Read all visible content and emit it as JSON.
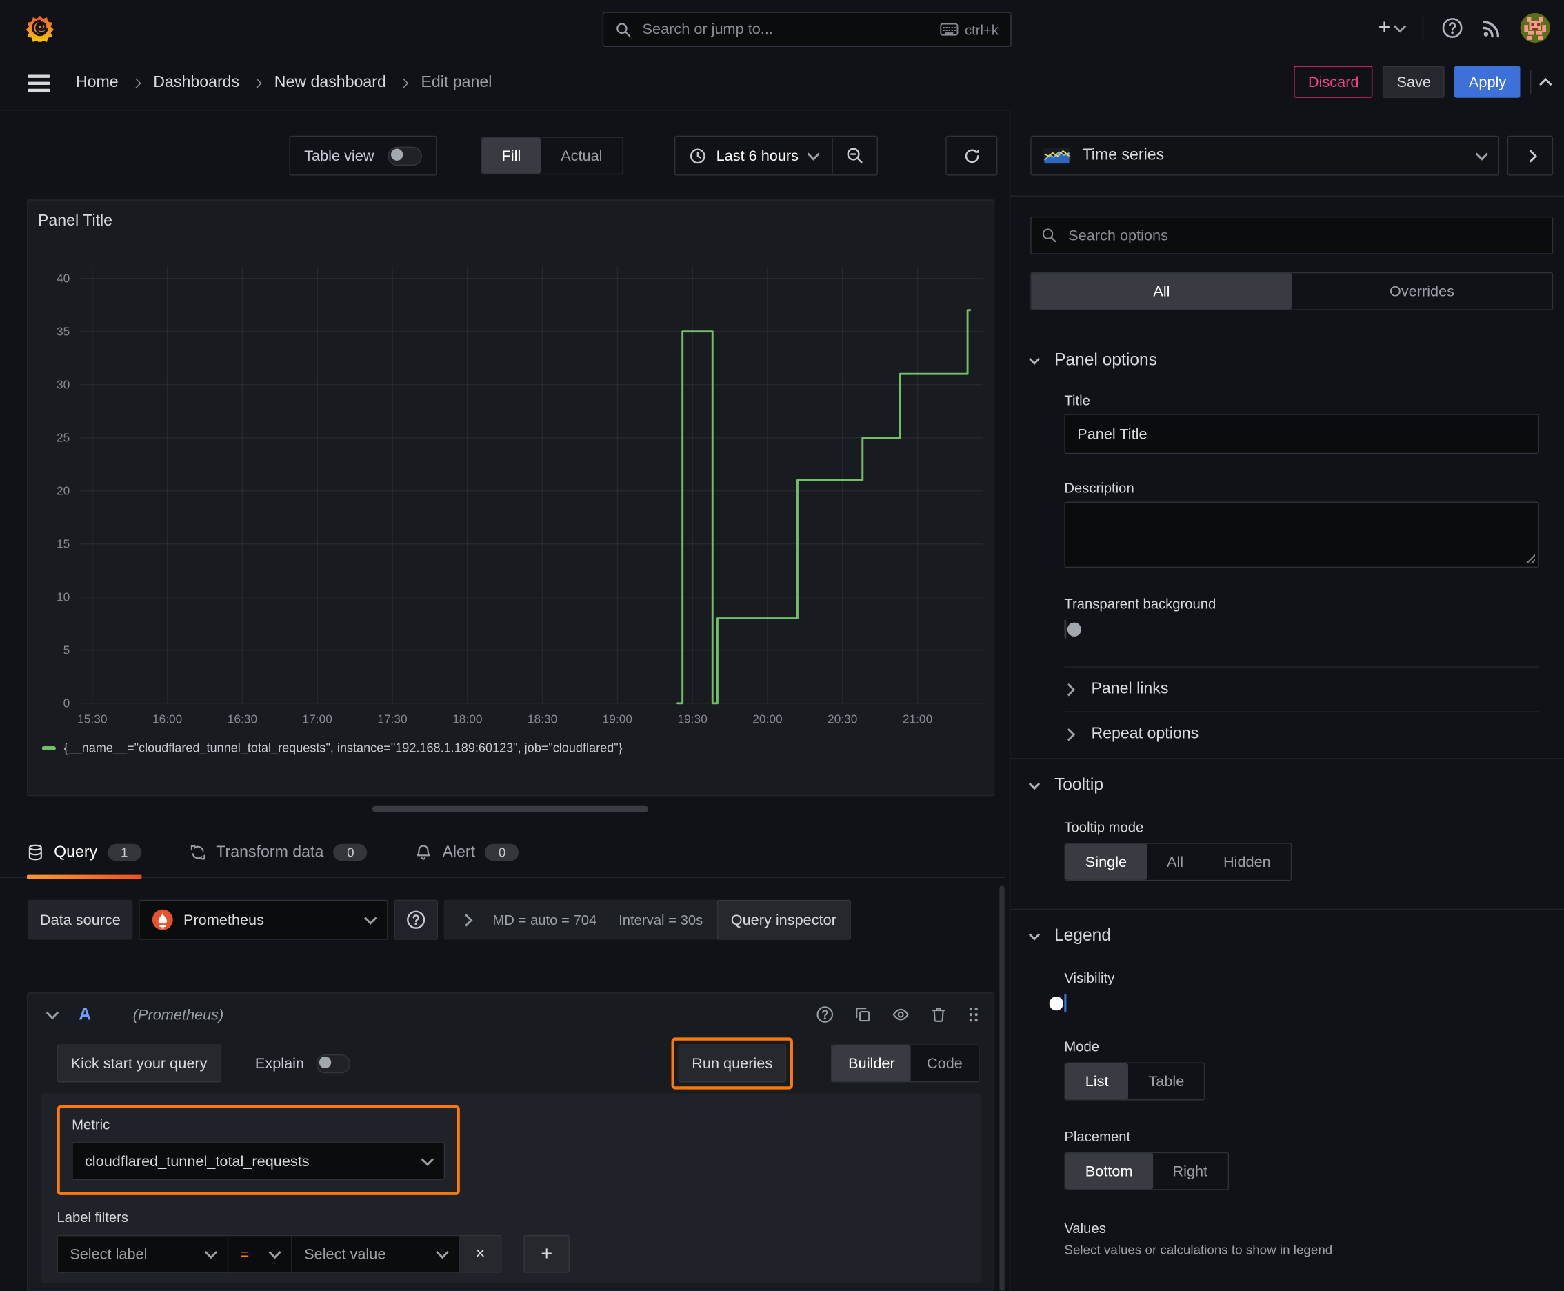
{
  "topbar": {
    "search_placeholder": "Search or jump to...",
    "shortcut": "ctrl+k",
    "new_icon": "+"
  },
  "breadcrumb": {
    "items": [
      "Home",
      "Dashboards",
      "New dashboard",
      "Edit panel"
    ]
  },
  "actions": {
    "discard": "Discard",
    "save": "Save",
    "apply": "Apply"
  },
  "panel_toolbar": {
    "table_view_label": "Table view",
    "fill": "Fill",
    "actual": "Actual",
    "time_range": "Last 6 hours"
  },
  "panel": {
    "title": "Panel Title"
  },
  "chart_data": {
    "type": "line",
    "title": "Panel Title",
    "x_ticks": [
      "15:30",
      "16:00",
      "16:30",
      "17:00",
      "17:30",
      "18:00",
      "18:30",
      "19:00",
      "19:30",
      "20:00",
      "20:30",
      "21:00"
    ],
    "y_ticks": [
      0,
      5,
      10,
      15,
      20,
      25,
      30,
      35,
      40
    ],
    "ylim": [
      0,
      40
    ],
    "x_window": [
      "15:25",
      "21:26"
    ],
    "grid": true,
    "legend_position": "bottom",
    "series": [
      {
        "name": "{__name__=\"cloudflared_tunnel_total_requests\", instance=\"192.168.1.189:60123\", job=\"cloudflared\"}",
        "color": "#73bf69",
        "line_style": "step-after",
        "points": [
          [
            "19:24",
            0
          ],
          [
            "19:26",
            0
          ],
          [
            "19:26",
            35
          ],
          [
            "19:38",
            35
          ],
          [
            "19:38",
            0
          ],
          [
            "19:40",
            0
          ],
          [
            "19:40",
            8
          ],
          [
            "20:12",
            8
          ],
          [
            "20:12",
            21
          ],
          [
            "20:38",
            21
          ],
          [
            "20:38",
            25
          ],
          [
            "20:53",
            25
          ],
          [
            "20:53",
            31
          ],
          [
            "21:20",
            31
          ],
          [
            "21:20",
            37
          ],
          [
            "21:21",
            37
          ]
        ]
      }
    ]
  },
  "query_tabs": {
    "query": "Query",
    "query_count": "1",
    "transform": "Transform data",
    "transform_count": "0",
    "alert": "Alert",
    "alert_count": "0"
  },
  "datasource_row": {
    "label": "Data source",
    "selected": "Prometheus",
    "stats_md": "MD = auto = 704",
    "stats_interval": "Interval = 30s",
    "inspector": "Query inspector"
  },
  "query_a": {
    "ref": "A",
    "hint": "(Prometheus)"
  },
  "query_actions": {
    "kickstart": "Kick start your query",
    "explain": "Explain",
    "run": "Run queries",
    "builder": "Builder",
    "code": "Code"
  },
  "metric": {
    "label": "Metric",
    "value": "cloudflared_tunnel_total_requests"
  },
  "label_filters": {
    "label": "Label filters",
    "select_label": "Select label",
    "operator": "=",
    "select_value": "Select value",
    "remove": "×",
    "add": "+"
  },
  "sidebar": {
    "viz_name": "Time series",
    "search_placeholder": "Search options",
    "scope": {
      "all": "All",
      "overrides": "Overrides"
    },
    "panel_options": {
      "heading": "Panel options",
      "title_label": "Title",
      "title_value": "Panel Title",
      "description_label": "Description",
      "transparent_label": "Transparent background"
    },
    "panel_links": "Panel links",
    "repeat_options": "Repeat options",
    "tooltip": {
      "heading": "Tooltip",
      "mode_label": "Tooltip mode",
      "single": "Single",
      "all": "All",
      "hidden": "Hidden"
    },
    "legend": {
      "heading": "Legend",
      "visibility_label": "Visibility",
      "mode_label": "Mode",
      "list": "List",
      "table": "Table",
      "placement_label": "Placement",
      "bottom": "Bottom",
      "right": "Right",
      "values_label": "Values",
      "values_hint": "Select values or calculations to show in legend"
    }
  },
  "colors": {
    "accent_orange": "#ff780a",
    "apply_blue": "#3d71d9",
    "discard_pink": "#e0226e",
    "series_green": "#73bf69",
    "toggle_on_blue": "#3d71d9"
  }
}
